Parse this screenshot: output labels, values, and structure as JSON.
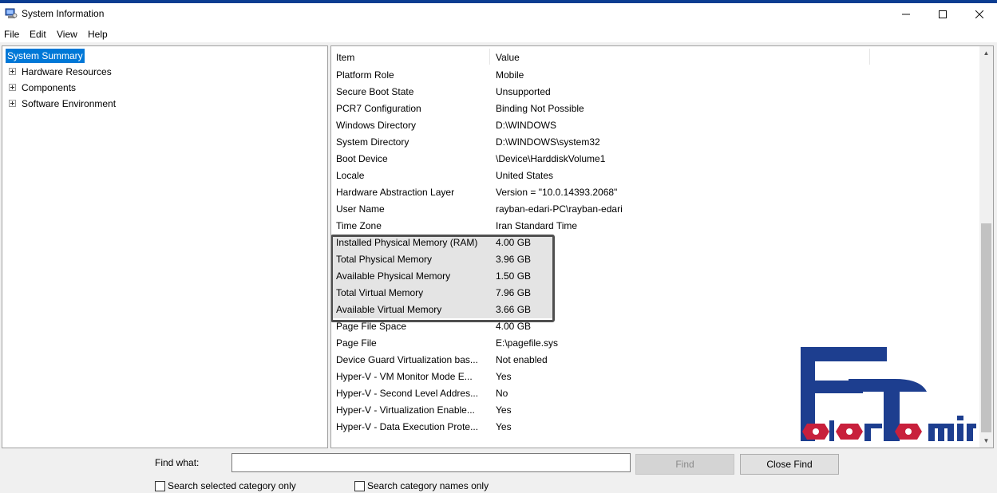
{
  "window": {
    "title": "System Information",
    "min_icon": "minimize-icon",
    "max_icon": "maximize-icon",
    "close_icon": "close-icon"
  },
  "menu": [
    "File",
    "Edit",
    "View",
    "Help"
  ],
  "tree": {
    "items": [
      {
        "label": "System Summary",
        "selected": true,
        "expandable": false
      },
      {
        "label": "Hardware Resources",
        "selected": false,
        "expandable": true
      },
      {
        "label": "Components",
        "selected": false,
        "expandable": true
      },
      {
        "label": "Software Environment",
        "selected": false,
        "expandable": true
      }
    ]
  },
  "table": {
    "columns": [
      "Item",
      "Value"
    ],
    "rows": [
      {
        "item": "Platform Role",
        "value": "Mobile",
        "highlighted": false
      },
      {
        "item": "Secure Boot State",
        "value": "Unsupported",
        "highlighted": false
      },
      {
        "item": "PCR7 Configuration",
        "value": "Binding Not Possible",
        "highlighted": false
      },
      {
        "item": "Windows Directory",
        "value": "D:\\WINDOWS",
        "highlighted": false
      },
      {
        "item": "System Directory",
        "value": "D:\\WINDOWS\\system32",
        "highlighted": false
      },
      {
        "item": "Boot Device",
        "value": "\\Device\\HarddiskVolume1",
        "highlighted": false
      },
      {
        "item": "Locale",
        "value": "United States",
        "highlighted": false
      },
      {
        "item": "Hardware Abstraction Layer",
        "value": "Version = \"10.0.14393.2068\"",
        "highlighted": false
      },
      {
        "item": "User Name",
        "value": "rayban-edari-PC\\rayban-edari",
        "highlighted": false
      },
      {
        "item": "Time Zone",
        "value": "Iran Standard Time",
        "highlighted": false
      },
      {
        "item": "Installed Physical Memory (RAM)",
        "value": "4.00 GB",
        "highlighted": true
      },
      {
        "item": "Total Physical Memory",
        "value": "3.96 GB",
        "highlighted": true
      },
      {
        "item": "Available Physical Memory",
        "value": "1.50 GB",
        "highlighted": true
      },
      {
        "item": "Total Virtual Memory",
        "value": "7.96 GB",
        "highlighted": true
      },
      {
        "item": "Available Virtual Memory",
        "value": "3.66 GB",
        "highlighted": true
      },
      {
        "item": "Page File Space",
        "value": "4.00 GB",
        "highlighted": false
      },
      {
        "item": "Page File",
        "value": "E:\\pagefile.sys",
        "highlighted": false
      },
      {
        "item": "Device Guard Virtualization bas...",
        "value": "Not enabled",
        "highlighted": false
      },
      {
        "item": "Hyper-V - VM Monitor Mode E...",
        "value": "Yes",
        "highlighted": false
      },
      {
        "item": "Hyper-V - Second Level Addres...",
        "value": "No",
        "highlighted": false
      },
      {
        "item": "Hyper-V - Virtualization Enable...",
        "value": "Yes",
        "highlighted": false
      },
      {
        "item": "Hyper-V - Data Execution Prote...",
        "value": "Yes",
        "highlighted": false
      }
    ]
  },
  "logo": {
    "text": "FaraTamir",
    "colors": {
      "blue": "#1d3e8f",
      "red": "#c8203c"
    }
  },
  "find": {
    "label": "Find what:",
    "value": "",
    "find_button": "Find",
    "close_button": "Close Find",
    "option1": "Search selected category only",
    "option2": "Search category names only"
  },
  "colors": {
    "selection": "#0078d7",
    "title_accent": "#0b3d91"
  }
}
